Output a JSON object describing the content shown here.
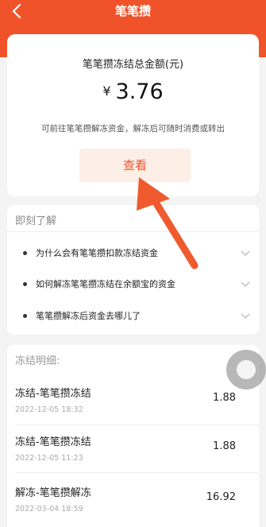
{
  "header": {
    "title": "笔笔攒",
    "back_icon": "chevron-left-icon",
    "color": "#f0532a"
  },
  "summary": {
    "label": "笔笔攒冻结总金额(元)",
    "currency": "¥",
    "amount": "3.76",
    "hint": "可前往笔笔攒解冻资金，解冻后可随时消费或转出",
    "view_button": "查看"
  },
  "faq": {
    "heading": "即刻了解",
    "items": [
      {
        "text": "为什么会有笔笔攒扣款冻结资金"
      },
      {
        "text": "如何解冻笔笔攒冻结在余额宝的资金"
      },
      {
        "text": "笔笔攒解冻后资金去哪儿了"
      }
    ]
  },
  "details": {
    "heading": "冻结明细:",
    "rows": [
      {
        "name": "冻结-笔笔攒冻结",
        "date": "2022-12-05 18:32",
        "amount": "1.88"
      },
      {
        "name": "冻结-笔笔攒冻结",
        "date": "2022-12-05 11:23",
        "amount": "1.88"
      },
      {
        "name": "解冻-笔笔攒解冻",
        "date": "2022-03-04 18:59",
        "amount": "16.92"
      }
    ]
  },
  "annotation": {
    "arrow_color": "#ef5a2e"
  }
}
